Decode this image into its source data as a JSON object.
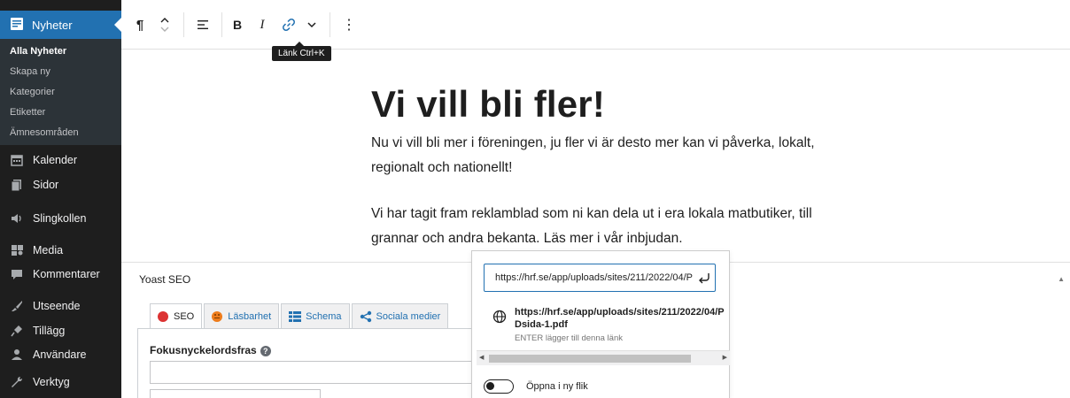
{
  "sidebar": {
    "header": {
      "label": "Nyheter",
      "icon": "posts-icon"
    },
    "submenu": [
      "Alla Nyheter",
      "Skapa ny",
      "Kategorier",
      "Etiketter",
      "Ämnesområden"
    ],
    "items": [
      {
        "label": "Kalender",
        "icon": "calendar-icon"
      },
      {
        "label": "Sidor",
        "icon": "pages-icon"
      },
      {
        "label": "Slingkollen",
        "icon": "audio-icon"
      },
      {
        "label": "Media",
        "icon": "media-icon"
      },
      {
        "label": "Kommentarer",
        "icon": "comments-icon"
      },
      {
        "label": "Utseende",
        "icon": "appearance-icon"
      },
      {
        "label": "Tillägg",
        "icon": "plugins-icon"
      },
      {
        "label": "Användare",
        "icon": "users-icon"
      },
      {
        "label": "Verktyg",
        "icon": "tools-icon"
      }
    ]
  },
  "toolbar": {
    "paragraph": "¶",
    "bold": "B",
    "italic": "I",
    "more": "⋮",
    "tooltip": "Länk  Ctrl+K"
  },
  "content": {
    "title": "Vi vill bli fler!",
    "paragraph1": "Nu vi vill bli mer i föreningen, ju fler vi är desto mer kan vi påverka, lokalt, regionalt och nationellt!",
    "paragraph2": "Vi har tagit fram reklamblad som ni kan dela ut i era lokala matbutiker, till grannar och andra bekanta. Läs mer i vår inbjudan."
  },
  "yoast": {
    "title": "Yoast SEO",
    "tabs": [
      {
        "label": "SEO",
        "color": "#dc3232"
      },
      {
        "label": "Läsbarhet",
        "color": "#ee7c1b"
      },
      {
        "label": "Schema"
      },
      {
        "label": "Sociala medier"
      }
    ],
    "focus_label": "Fokusnyckelordsfras",
    "help": "?"
  },
  "link_popover": {
    "url_value": "https://hrf.se/app/uploads/sites/211/2022/04/P",
    "suggestion_title": "https://hrf.se/app/uploads/sites/211/2022/04/PDsida-1.pdf",
    "suggestion_info": "ENTER lägger till denna länk",
    "new_tab_label": "Öppna i ny flik"
  },
  "colors": {
    "accent": "#2271b1",
    "sidebar_bg": "#1e1e1e",
    "submenu_bg": "#2c3338"
  }
}
